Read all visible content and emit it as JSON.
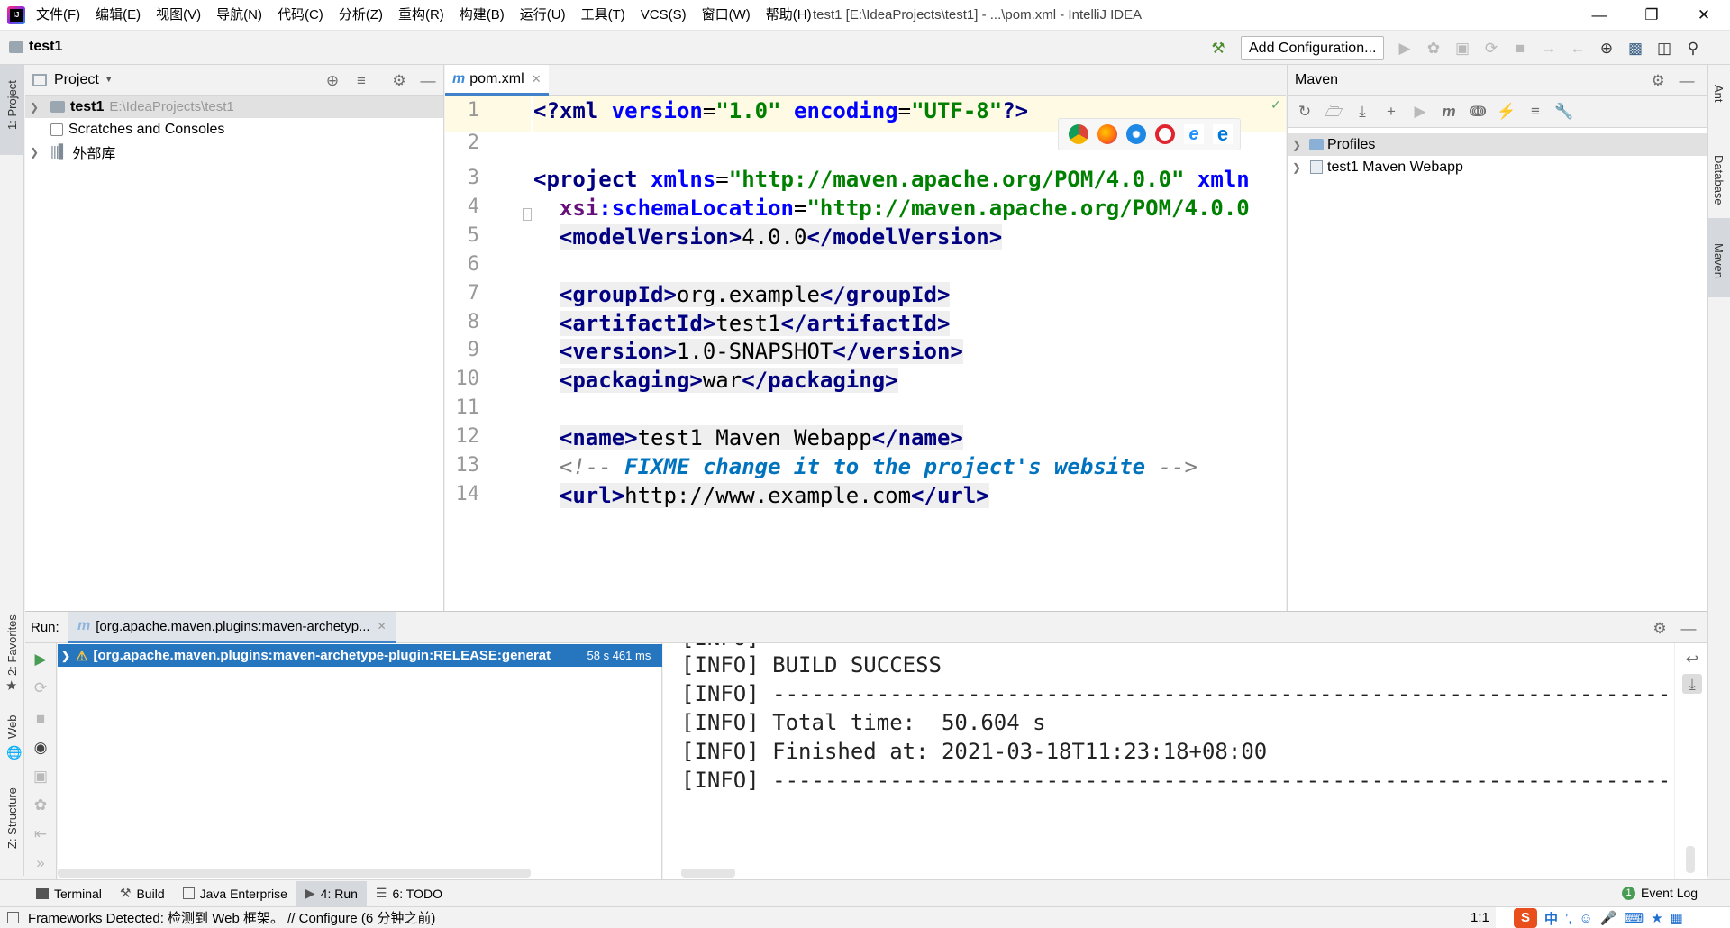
{
  "window": {
    "title": "test1 [E:\\IdeaProjects\\test1] - ...\\pom.xml - IntelliJ IDEA",
    "menu": [
      "文件(F)",
      "编辑(E)",
      "视图(V)",
      "导航(N)",
      "代码(C)",
      "分析(Z)",
      "重构(R)",
      "构建(B)",
      "运行(U)",
      "工具(T)",
      "VCS(S)",
      "窗口(W)",
      "帮助(H)"
    ]
  },
  "navbar": {
    "breadcrumb": "test1",
    "add_configuration": "Add Configuration..."
  },
  "left_stripe": {
    "project": "1: Project",
    "favorites": "2: Favorites",
    "web": "Web",
    "structure": "Z: Structure"
  },
  "right_stripe": {
    "ant": "Ant",
    "database": "Database",
    "maven": "Maven"
  },
  "project_panel": {
    "title": "Project",
    "items": [
      {
        "name": "test1",
        "path": "E:\\IdeaProjects\\test1"
      },
      {
        "name": "Scratches and Consoles"
      },
      {
        "name": "外部库"
      }
    ]
  },
  "editor": {
    "tab": "pom.xml",
    "line_numbers": [
      "1",
      "2",
      "3",
      "4",
      "5",
      "6",
      "7",
      "8",
      "9",
      "10",
      "11",
      "12",
      "13",
      "14"
    ],
    "lines": [
      "<?xml version=\"1.0\" encoding=\"UTF-8\"?>",
      "",
      "<project xmlns=\"http://maven.apache.org/POM/4.0.0\" xmln",
      "  xsi:schemaLocation=\"http://maven.apache.org/POM/4.0.0",
      "  <modelVersion>4.0.0</modelVersion>",
      "",
      "  <groupId>org.example</groupId>",
      "  <artifactId>test1</artifactId>",
      "  <version>1.0-SNAPSHOT</version>",
      "  <packaging>war</packaging>",
      "",
      "  <name>test1 Maven Webapp</name>",
      "  <!-- FIXME change it to the project's website -->",
      "  <url>http://www.example.com</url>"
    ]
  },
  "maven_panel": {
    "title": "Maven",
    "items": [
      "Profiles",
      "test1 Maven Webapp"
    ]
  },
  "run_panel": {
    "label": "Run:",
    "tab": "[org.apache.maven.plugins:maven-archetyp...",
    "tree_item": "[org.apache.maven.plugins:maven-archetype-plugin:RELEASE:generat",
    "tree_time": "58 s 461 ms",
    "console": [
      "[INFO] BUILD SUCCESS",
      "[INFO] ------------------------------------------------------------------------",
      "[INFO] Total time:  50.604 s",
      "[INFO] Finished at: 2021-03-18T11:23:18+08:00",
      "[INFO] ------------------------------------------------------------------------"
    ]
  },
  "bottom_tabs": {
    "terminal": "Terminal",
    "build": "Build",
    "java_enterprise": "Java Enterprise",
    "run": "4: Run",
    "todo": "6: TODO",
    "event_log": "Event Log",
    "event_count": "1"
  },
  "status": {
    "message": "Frameworks Detected: 检测到 Web 框架。 // Configure (6 分钟之前)",
    "position": "1:1",
    "ime": "中"
  },
  "colors": {
    "accent": "#4083c9",
    "selection": "#2675bf",
    "line_highlight": "#fffae3"
  }
}
